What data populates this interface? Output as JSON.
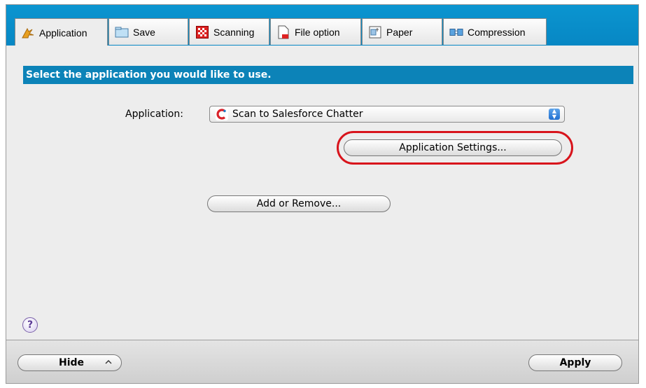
{
  "tabs": [
    {
      "label": "Application",
      "icon": "application-icon",
      "active": true
    },
    {
      "label": "Save",
      "icon": "save-folder-icon"
    },
    {
      "label": "Scanning",
      "icon": "scanning-icon"
    },
    {
      "label": "File option",
      "icon": "file-option-icon"
    },
    {
      "label": "Paper",
      "icon": "paper-icon"
    },
    {
      "label": "Compression",
      "icon": "compression-icon"
    }
  ],
  "banner": "Select the application you would like to use.",
  "application": {
    "label": "Application:",
    "selected": "Scan to Salesforce Chatter"
  },
  "buttons": {
    "app_settings": "Application Settings...",
    "add_remove": "Add or Remove...",
    "hide": "Hide",
    "apply": "Apply"
  },
  "help": "?",
  "colors": {
    "tabbar": "#0b95d0",
    "banner": "#0c83b8",
    "highlight": "#d8141c"
  }
}
